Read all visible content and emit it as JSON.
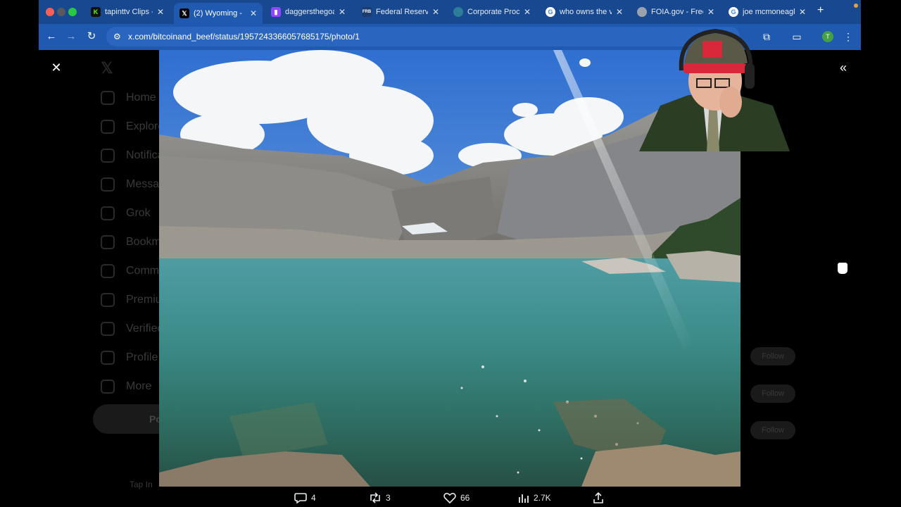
{
  "browser": {
    "tabs": [
      {
        "title": "tapinttv Clips -",
        "favicon": "kick-icon",
        "color": "#53fc18"
      },
      {
        "title": "(2) Wyoming - ",
        "favicon": "x-icon",
        "color": "#000000",
        "active": true
      },
      {
        "title": "daggersthegoat",
        "favicon": "twitch-icon",
        "color": "#9146ff"
      },
      {
        "title": "Federal Reserve",
        "favicon": "frb-icon",
        "color": "#1a3c6e"
      },
      {
        "title": "Corporate Proce",
        "favicon": "globe-icon",
        "color": "#2e7d9a"
      },
      {
        "title": "who owns the v",
        "favicon": "google-icon",
        "color": "#ffffff"
      },
      {
        "title": "FOIA.gov - Free",
        "favicon": "seal-icon",
        "color": "#9aa3ad"
      },
      {
        "title": "joe mcmoneagl",
        "favicon": "google-icon",
        "color": "#ffffff"
      }
    ],
    "url": "x.com/bitcoinand_beef/status/1957243366057685175/photo/1",
    "profile_initial": "T"
  },
  "background": {
    "sidebar": [
      "Home",
      "Explore",
      "Notifications",
      "Messages",
      "Grok",
      "Bookmarks",
      "Communities",
      "Premium",
      "Verified Orgs",
      "Profile",
      "More"
    ],
    "post_label": "Post",
    "follow_labels": [
      "Follow",
      "Follow",
      "Follow"
    ],
    "account_hint": "Tap In"
  },
  "photo_viewer": {
    "replies": "4",
    "reposts": "3",
    "likes": "66",
    "views": "2.7K"
  },
  "colors": {
    "chrome_blue": "#1f5ab0",
    "tabbar_blue": "#18488f",
    "backdrop": "#000000"
  }
}
